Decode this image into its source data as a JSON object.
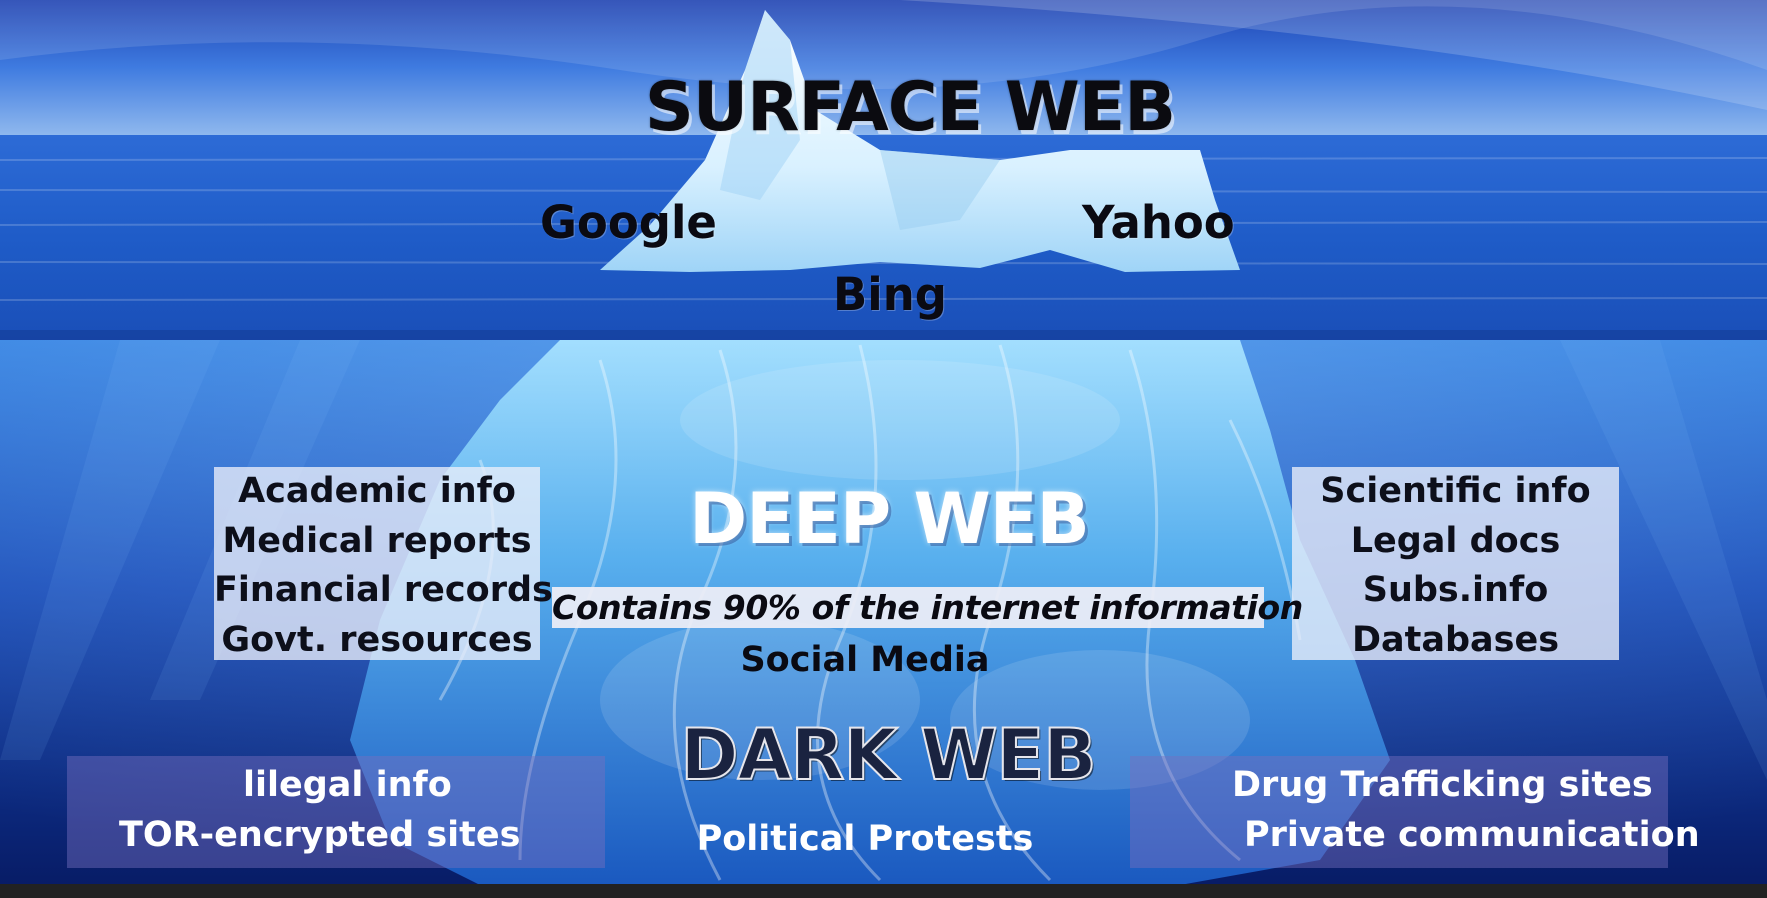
{
  "surface": {
    "title": "SURFACE WEB",
    "engines": {
      "google": "Google",
      "yahoo": "Yahoo",
      "bing": "Bing"
    }
  },
  "deep": {
    "title": "DEEP WEB",
    "left_items": [
      "Academic info",
      "Medical reports",
      "Financial records",
      "Govt. resources"
    ],
    "right_items": [
      "Scientific info",
      "Legal docs",
      "Subs.info",
      "Databases"
    ],
    "banner": "Contains 90% of the internet information",
    "social": "Social Media"
  },
  "dark": {
    "title": "DARK WEB",
    "left_items": [
      "lilegal info",
      "TOR-encrypted sites"
    ],
    "right_items": [
      "Drug Trafficking sites",
      "Private communication"
    ],
    "center": "Political Protests"
  },
  "colors": {
    "sky": "#1a4fc4",
    "sea": "#1d5fd0",
    "deep_water": "#0a2a7a",
    "ice": "#bfe6ff",
    "bottom_bar": "#222222"
  }
}
